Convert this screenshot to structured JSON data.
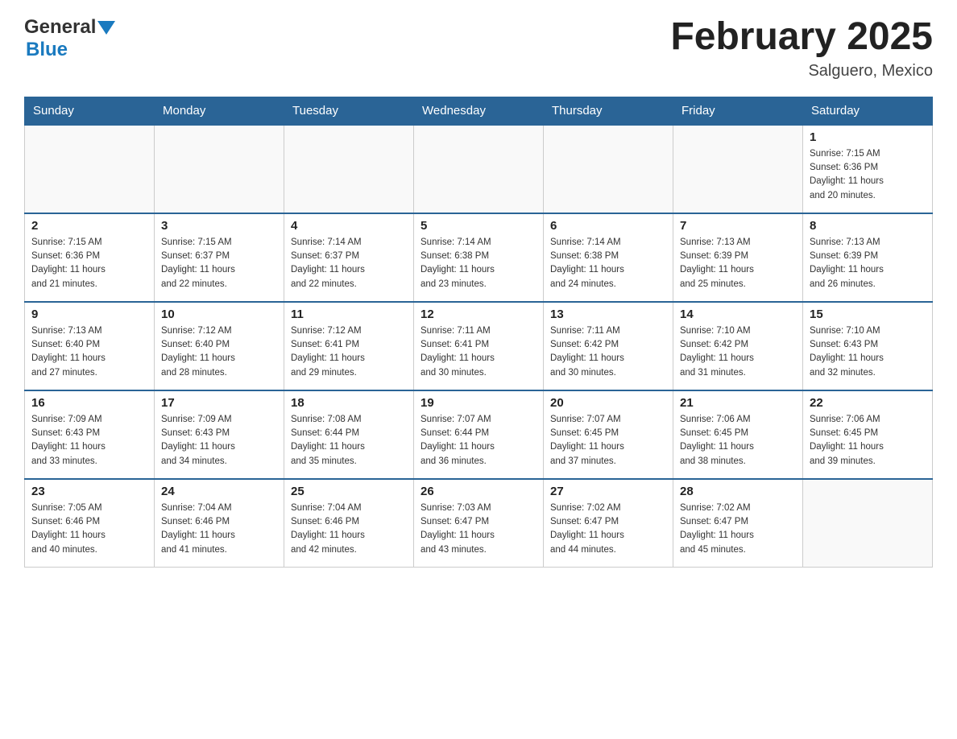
{
  "header": {
    "logo_general": "General",
    "logo_blue": "Blue",
    "title": "February 2025",
    "subtitle": "Salguero, Mexico"
  },
  "days_of_week": [
    "Sunday",
    "Monday",
    "Tuesday",
    "Wednesday",
    "Thursday",
    "Friday",
    "Saturday"
  ],
  "weeks": [
    [
      {
        "day": "",
        "info": ""
      },
      {
        "day": "",
        "info": ""
      },
      {
        "day": "",
        "info": ""
      },
      {
        "day": "",
        "info": ""
      },
      {
        "day": "",
        "info": ""
      },
      {
        "day": "",
        "info": ""
      },
      {
        "day": "1",
        "info": "Sunrise: 7:15 AM\nSunset: 6:36 PM\nDaylight: 11 hours\nand 20 minutes."
      }
    ],
    [
      {
        "day": "2",
        "info": "Sunrise: 7:15 AM\nSunset: 6:36 PM\nDaylight: 11 hours\nand 21 minutes."
      },
      {
        "day": "3",
        "info": "Sunrise: 7:15 AM\nSunset: 6:37 PM\nDaylight: 11 hours\nand 22 minutes."
      },
      {
        "day": "4",
        "info": "Sunrise: 7:14 AM\nSunset: 6:37 PM\nDaylight: 11 hours\nand 22 minutes."
      },
      {
        "day": "5",
        "info": "Sunrise: 7:14 AM\nSunset: 6:38 PM\nDaylight: 11 hours\nand 23 minutes."
      },
      {
        "day": "6",
        "info": "Sunrise: 7:14 AM\nSunset: 6:38 PM\nDaylight: 11 hours\nand 24 minutes."
      },
      {
        "day": "7",
        "info": "Sunrise: 7:13 AM\nSunset: 6:39 PM\nDaylight: 11 hours\nand 25 minutes."
      },
      {
        "day": "8",
        "info": "Sunrise: 7:13 AM\nSunset: 6:39 PM\nDaylight: 11 hours\nand 26 minutes."
      }
    ],
    [
      {
        "day": "9",
        "info": "Sunrise: 7:13 AM\nSunset: 6:40 PM\nDaylight: 11 hours\nand 27 minutes."
      },
      {
        "day": "10",
        "info": "Sunrise: 7:12 AM\nSunset: 6:40 PM\nDaylight: 11 hours\nand 28 minutes."
      },
      {
        "day": "11",
        "info": "Sunrise: 7:12 AM\nSunset: 6:41 PM\nDaylight: 11 hours\nand 29 minutes."
      },
      {
        "day": "12",
        "info": "Sunrise: 7:11 AM\nSunset: 6:41 PM\nDaylight: 11 hours\nand 30 minutes."
      },
      {
        "day": "13",
        "info": "Sunrise: 7:11 AM\nSunset: 6:42 PM\nDaylight: 11 hours\nand 30 minutes."
      },
      {
        "day": "14",
        "info": "Sunrise: 7:10 AM\nSunset: 6:42 PM\nDaylight: 11 hours\nand 31 minutes."
      },
      {
        "day": "15",
        "info": "Sunrise: 7:10 AM\nSunset: 6:43 PM\nDaylight: 11 hours\nand 32 minutes."
      }
    ],
    [
      {
        "day": "16",
        "info": "Sunrise: 7:09 AM\nSunset: 6:43 PM\nDaylight: 11 hours\nand 33 minutes."
      },
      {
        "day": "17",
        "info": "Sunrise: 7:09 AM\nSunset: 6:43 PM\nDaylight: 11 hours\nand 34 minutes."
      },
      {
        "day": "18",
        "info": "Sunrise: 7:08 AM\nSunset: 6:44 PM\nDaylight: 11 hours\nand 35 minutes."
      },
      {
        "day": "19",
        "info": "Sunrise: 7:07 AM\nSunset: 6:44 PM\nDaylight: 11 hours\nand 36 minutes."
      },
      {
        "day": "20",
        "info": "Sunrise: 7:07 AM\nSunset: 6:45 PM\nDaylight: 11 hours\nand 37 minutes."
      },
      {
        "day": "21",
        "info": "Sunrise: 7:06 AM\nSunset: 6:45 PM\nDaylight: 11 hours\nand 38 minutes."
      },
      {
        "day": "22",
        "info": "Sunrise: 7:06 AM\nSunset: 6:45 PM\nDaylight: 11 hours\nand 39 minutes."
      }
    ],
    [
      {
        "day": "23",
        "info": "Sunrise: 7:05 AM\nSunset: 6:46 PM\nDaylight: 11 hours\nand 40 minutes."
      },
      {
        "day": "24",
        "info": "Sunrise: 7:04 AM\nSunset: 6:46 PM\nDaylight: 11 hours\nand 41 minutes."
      },
      {
        "day": "25",
        "info": "Sunrise: 7:04 AM\nSunset: 6:46 PM\nDaylight: 11 hours\nand 42 minutes."
      },
      {
        "day": "26",
        "info": "Sunrise: 7:03 AM\nSunset: 6:47 PM\nDaylight: 11 hours\nand 43 minutes."
      },
      {
        "day": "27",
        "info": "Sunrise: 7:02 AM\nSunset: 6:47 PM\nDaylight: 11 hours\nand 44 minutes."
      },
      {
        "day": "28",
        "info": "Sunrise: 7:02 AM\nSunset: 6:47 PM\nDaylight: 11 hours\nand 45 minutes."
      },
      {
        "day": "",
        "info": ""
      }
    ]
  ]
}
